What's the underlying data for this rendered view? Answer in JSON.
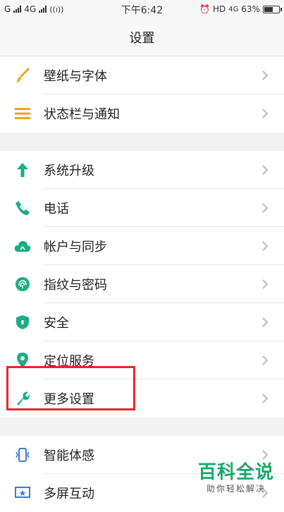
{
  "statusbar": {
    "carrier1": "G",
    "carrier2": "4G",
    "time": "下午6:42",
    "hd": "HD",
    "net": "4G",
    "battery_text": "63%",
    "battery_level": 0.63
  },
  "titlebar": {
    "title": "设置"
  },
  "groups": {
    "g1": {
      "wallpaper": "壁纸与字体",
      "statusbar_notify": "状态栏与通知"
    },
    "g2": {
      "system_upgrade": "系统升级",
      "phone": "电话",
      "account_sync": "帐户与同步",
      "fingerprint_password": "指纹与密码",
      "security": "安全",
      "location": "定位服务",
      "more_settings": "更多设置"
    },
    "g3": {
      "smart_motion": "智能体感",
      "multi_screen": "多屏互动"
    }
  },
  "colors": {
    "accent": "#1aae82",
    "orange": "#f3a21a",
    "blue": "#3a7bd5",
    "highlight": "#e8262d"
  },
  "watermark": {
    "title": "百科全说",
    "subtitle": "助你轻松解决"
  }
}
